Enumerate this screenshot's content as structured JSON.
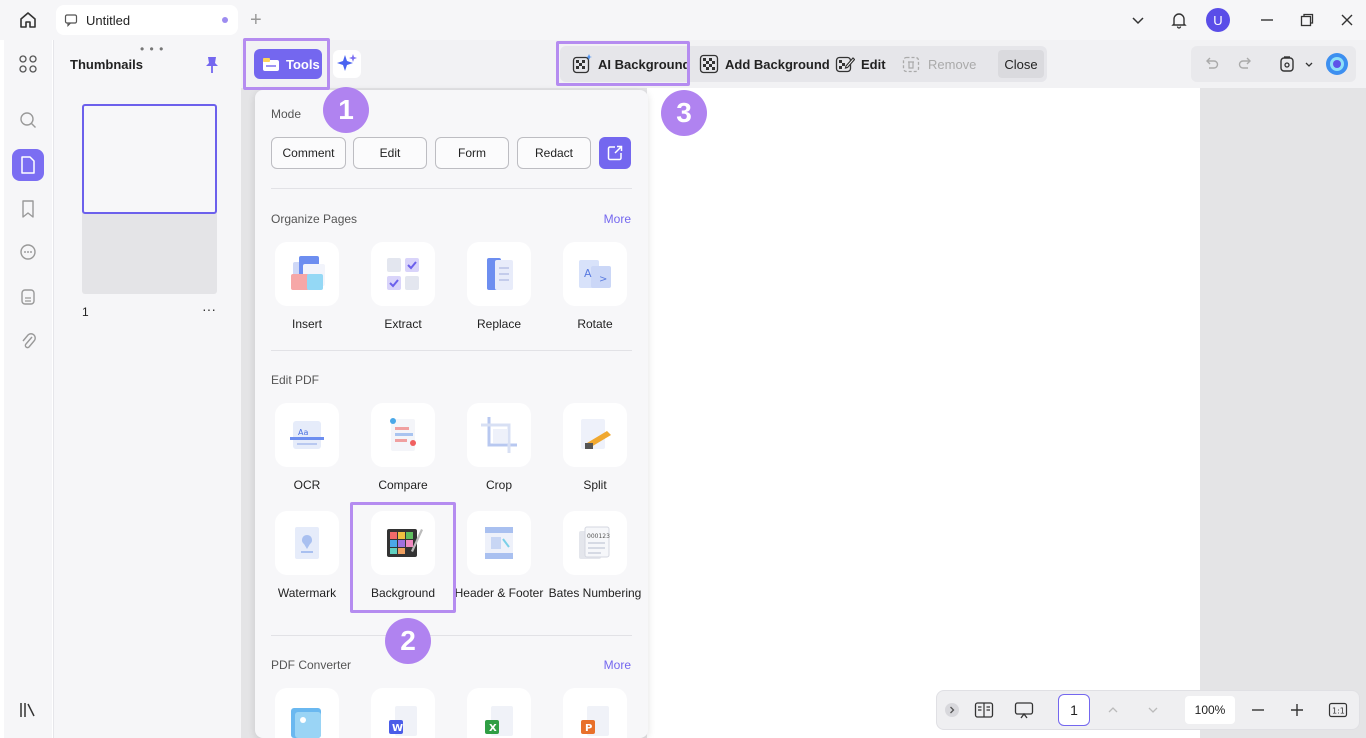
{
  "window": {
    "tab_title": "Untitled",
    "new_tab": "+",
    "avatar_initial": "U"
  },
  "thumbnails": {
    "title": "Thumbnails",
    "handle": "• • •",
    "pages": [
      {
        "number": "1",
        "more": "···"
      }
    ]
  },
  "toolbar": {
    "tools_label": "Tools",
    "background_actions": [
      {
        "label": "AI Background",
        "enabled": true
      },
      {
        "label": "Add Background",
        "enabled": true
      },
      {
        "label": "Edit",
        "enabled": true
      },
      {
        "label": "Remove",
        "enabled": false
      }
    ],
    "close_label": "Close"
  },
  "tools_menu": {
    "mode": {
      "title": "Mode",
      "buttons": [
        "Comment",
        "Edit",
        "Form",
        "Redact"
      ]
    },
    "organize": {
      "title": "Organize Pages",
      "more": "More",
      "items": [
        "Insert",
        "Extract",
        "Replace",
        "Rotate"
      ]
    },
    "edit_pdf": {
      "title": "Edit PDF",
      "items": [
        "OCR",
        "Compare",
        "Crop",
        "Split",
        "Watermark",
        "Background",
        "Header & Footer",
        "Bates Numbering"
      ]
    },
    "converter": {
      "title": "PDF Converter",
      "more": "More"
    }
  },
  "callouts": [
    "1",
    "2",
    "3"
  ],
  "navbar": {
    "page": "1",
    "zoom": "100%",
    "fit_label": "1:1"
  },
  "colors": {
    "accent": "#7467ef",
    "highlight": "#b58cf0"
  }
}
